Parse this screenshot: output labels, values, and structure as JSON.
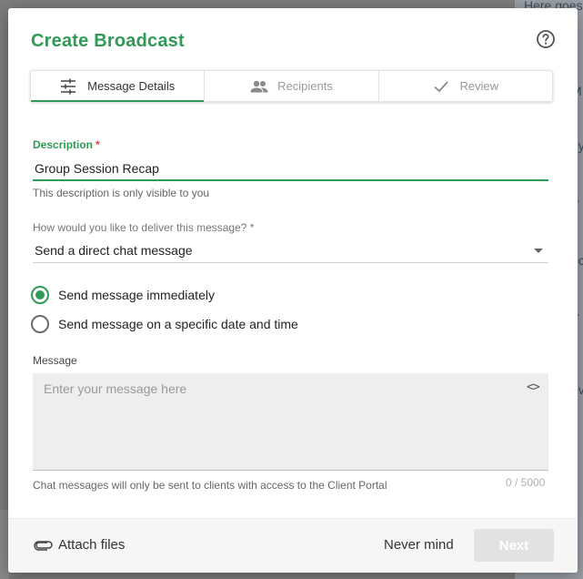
{
  "background": {
    "peek_lines": [
      "Here goes",
      "e",
      "M",
      "ey",
      "tr",
      "oc",
      "tr",
      "ov",
      "r"
    ]
  },
  "modal": {
    "title": "Create Broadcast",
    "help_icon": "help-circle-icon"
  },
  "tabs": [
    {
      "label": "Message Details",
      "icon": "sliders-icon",
      "active": true
    },
    {
      "label": "Recipients",
      "icon": "people-icon",
      "active": false
    },
    {
      "label": "Review",
      "icon": "check-icon",
      "active": false
    }
  ],
  "description": {
    "label": "Description",
    "required_mark": "*",
    "value": "Group Session Recap",
    "hint": "This description is only visible to you"
  },
  "delivery": {
    "label": "How would you like to deliver this message? *",
    "selected": "Send a direct chat message"
  },
  "schedule": {
    "options": [
      {
        "label": "Send message immediately",
        "checked": true
      },
      {
        "label": "Send message on a specific date and time",
        "checked": false
      }
    ]
  },
  "message": {
    "label": "Message",
    "placeholder": "Enter your message here",
    "code_toggle": "<>",
    "hint": "Chat messages will only be sent to clients with access to the Client Portal",
    "counter": "0 / 5000"
  },
  "footer": {
    "attach_label": "Attach files",
    "cancel_label": "Never mind",
    "next_label": "Next"
  },
  "colors": {
    "accent": "#2e9b57",
    "required": "#e0453b",
    "disabled_button": "#e2e2e2"
  }
}
